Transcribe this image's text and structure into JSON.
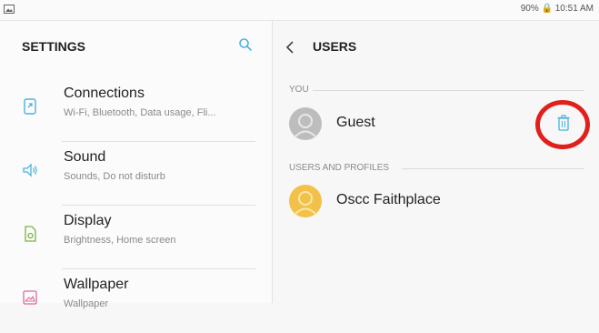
{
  "status_bar": {
    "battery_time": "90% 🔒 10:51 AM"
  },
  "settings": {
    "title": "SETTINGS",
    "items": [
      {
        "title": "Connections",
        "subtitle": "Wi-Fi, Bluetooth, Data usage, Fli..."
      },
      {
        "title": "Sound",
        "subtitle": "Sounds, Do not disturb"
      },
      {
        "title": "Display",
        "subtitle": "Brightness, Home screen"
      },
      {
        "title": "Wallpaper",
        "subtitle": "Wallpaper"
      }
    ]
  },
  "users_panel": {
    "title": "USERS",
    "you_label": "YOU",
    "guest_name": "Guest",
    "profiles_label": "USERS AND PROFILES",
    "profile_name": "Oscc Faithplace"
  },
  "colors": {
    "accent": "#4bb3e0",
    "highlight_circle": "#e0201a",
    "profile_avatar": "#f2c14a",
    "guest_avatar": "#bdbdbd"
  }
}
